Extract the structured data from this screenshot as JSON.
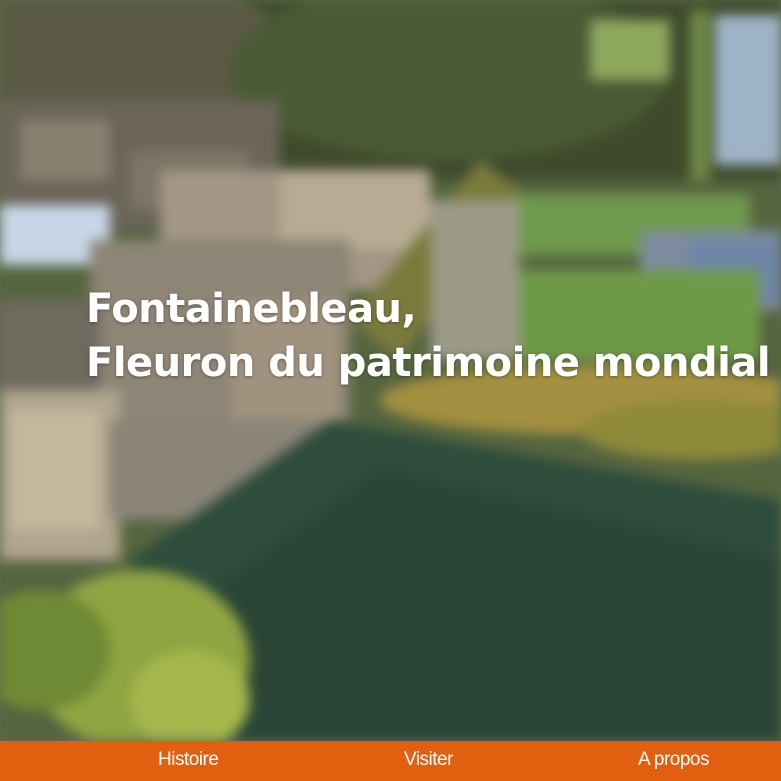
{
  "hero": {
    "title_line1": "Fontainebleau,",
    "title_line2": "Fleuron du patrimoine mondial",
    "image_subject": "aerial view of the Château de Fontainebleau, gardens and carp pond"
  },
  "nav": {
    "items": [
      {
        "label": "Histoire"
      },
      {
        "label": "Visiter"
      },
      {
        "label": "A propos"
      }
    ]
  },
  "colors": {
    "nav_background": "#e35f10",
    "nav_text": "#ffffff",
    "title_text": "#ffffff"
  }
}
